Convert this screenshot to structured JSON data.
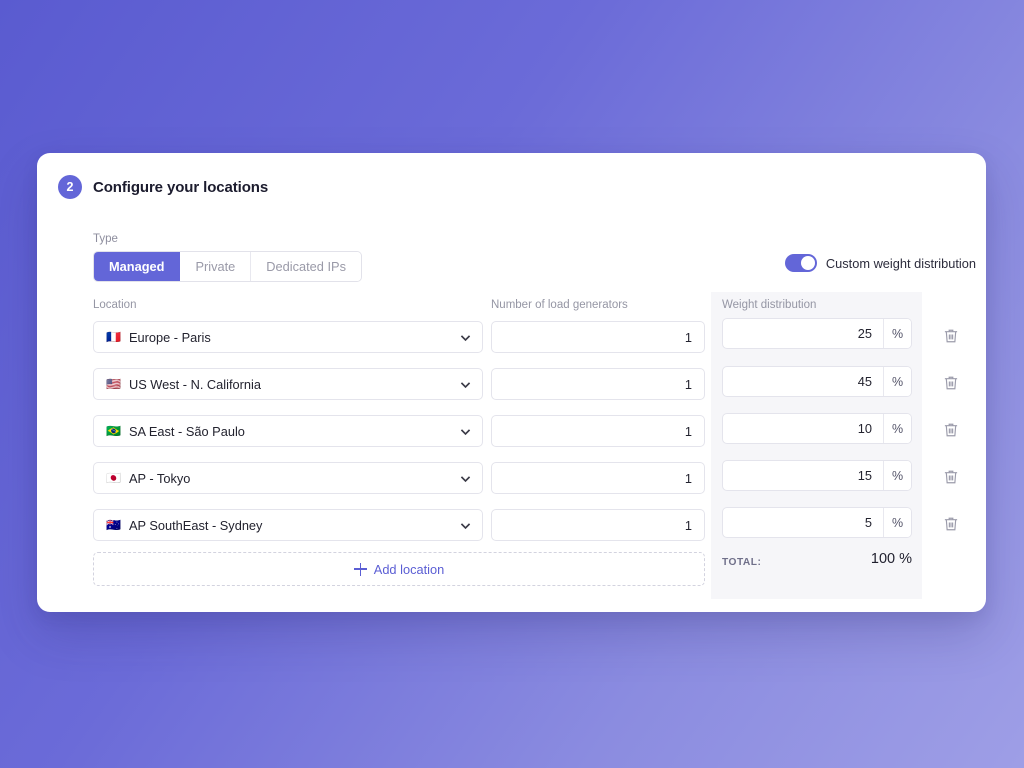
{
  "card": {
    "step_number": "2",
    "title": "Configure your locations"
  },
  "type_section": {
    "label": "Type",
    "options": [
      {
        "label": "Managed",
        "active": true
      },
      {
        "label": "Private",
        "active": false
      },
      {
        "label": "Dedicated IPs",
        "active": false
      }
    ]
  },
  "custom_weight_toggle": {
    "label": "Custom weight distribution",
    "enabled": true,
    "accent_color": "#6366d8"
  },
  "columns": {
    "location": "Location",
    "generators": "Number of load generators",
    "weight": "Weight distribution"
  },
  "rows": [
    {
      "flag": "🇫🇷",
      "location": "Europe - Paris",
      "generators": "1",
      "weight": "25",
      "unit": "%",
      "delete_icon": "trash-icon"
    },
    {
      "flag": "🇺🇸",
      "location": "US West - N. California",
      "generators": "1",
      "weight": "45",
      "unit": "%",
      "delete_icon": "trash-icon"
    },
    {
      "flag": "🇧🇷",
      "location": "SA East - São Paulo",
      "generators": "1",
      "weight": "10",
      "unit": "%",
      "delete_icon": "trash-icon"
    },
    {
      "flag": "🇯🇵",
      "location": "AP - Tokyo",
      "generators": "1",
      "weight": "15",
      "unit": "%",
      "delete_icon": "trash-icon"
    },
    {
      "flag": "🇦🇺",
      "location": "AP SouthEast - Sydney",
      "generators": "1",
      "weight": "5",
      "unit": "%",
      "delete_icon": "trash-icon"
    }
  ],
  "add_location": {
    "label": "Add location",
    "icon": "plus-icon"
  },
  "total": {
    "label": "TOTAL:",
    "value": "100 %"
  }
}
